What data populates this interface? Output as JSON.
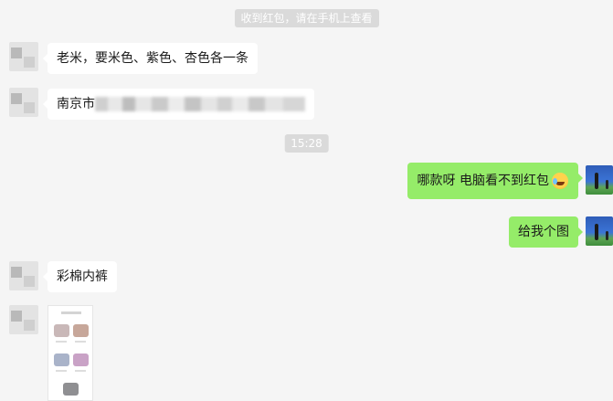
{
  "system_notice": "收到红包，请在手机上查看",
  "timestamp": "15:28",
  "messages": [
    {
      "side": "left",
      "text": "老米，要米色、紫色、杏色各一条"
    },
    {
      "side": "left",
      "text_prefix": "南京市"
    },
    {
      "side": "right",
      "text": "哪款呀  电脑看不到红包",
      "icon": "rolling-laughing-emoji-icon"
    },
    {
      "side": "right",
      "text": "给我个图"
    },
    {
      "side": "left",
      "text": "彩棉内裤"
    },
    {
      "side": "left",
      "type": "image",
      "icon": "product-image-thumbnail"
    }
  ],
  "colors": {
    "background": "#f5f5f5",
    "incoming_bubble": "#ffffff",
    "outgoing_bubble": "#95ec69",
    "system_tag": "#dadada"
  },
  "thumbnail_swatches": [
    "#c9b8b8",
    "#c7a79a",
    "#a9b3c9",
    "#c9a2c6",
    "#8f8f92"
  ]
}
